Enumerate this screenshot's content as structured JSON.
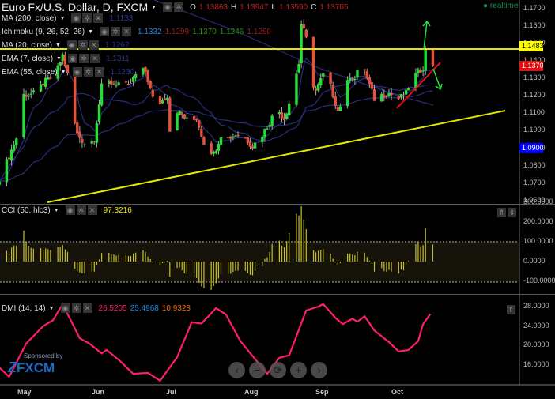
{
  "header": {
    "symbol": "Euro Fx/U.S. Dollar, D, FXCM",
    "o_label": "O",
    "o": "1.13863",
    "h_label": "H",
    "h": "1.13947",
    "l_label": "L",
    "l": "1.13590",
    "c_label": "C",
    "c": "1.13705"
  },
  "realtime": "realtime",
  "indicators": [
    {
      "label": "MA (200, close)",
      "values": [
        {
          "v": "1.1133",
          "color": "#2a3590"
        }
      ]
    },
    {
      "label": "Ichimoku (9, 26, 52, 26)",
      "values": [
        {
          "v": "1.1332",
          "color": "#1e88e5"
        },
        {
          "v": "1.1299",
          "color": "#a01818"
        },
        {
          "v": "1.1370",
          "color": "#2a8a10"
        },
        {
          "v": "1.1246",
          "color": "#2a8a10"
        },
        {
          "v": "1.1260",
          "color": "#a01818"
        }
      ]
    },
    {
      "label": "MA (20, close)",
      "values": [
        {
          "v": "1.1262",
          "color": "#2a3590"
        }
      ]
    },
    {
      "label": "EMA (7, close)",
      "values": [
        {
          "v": "1.1311",
          "color": "#2a3590"
        }
      ]
    },
    {
      "label": "EMA (55, close)",
      "values": [
        {
          "v": "1.1230",
          "color": "#2a3590"
        }
      ]
    }
  ],
  "price_axis": {
    "ticks": [
      "1.1700",
      "1.1600",
      "1.1500",
      "1.1400",
      "1.1300",
      "1.1200",
      "1.1100",
      "1.1000",
      "1.0900",
      "1.0800",
      "1.0700",
      "1.0600"
    ],
    "tags": [
      {
        "v": "1.1483",
        "bg": "#ffff00",
        "fg": "#000"
      },
      {
        "v": "1.1370",
        "bg": "#e01010",
        "fg": "#fff"
      },
      {
        "v": "1.0900",
        "bg": "#0000ff",
        "fg": "#fff"
      }
    ]
  },
  "cci": {
    "label": "CCI (50, hlc3)",
    "value": "97.3216",
    "ticks": [
      "300.0000",
      "200.0000",
      "100.0000",
      "0.0000",
      "-100.0000"
    ]
  },
  "dmi": {
    "label": "DMI (14, 14)",
    "values": [
      {
        "v": "26.5205",
        "color": "#ff1e6e"
      },
      {
        "v": "25.4968",
        "color": "#1e88e5"
      },
      {
        "v": "10.9323",
        "color": "#ff6a00"
      }
    ],
    "ticks": [
      "28.0000",
      "24.0000",
      "20.0000",
      "16.0000"
    ]
  },
  "time_axis": [
    "May",
    "Jun",
    "Jul",
    "Aug",
    "Sep",
    "Oct"
  ],
  "sponsor": {
    "text": "Sponsored by",
    "brand": "FXCM"
  },
  "nav_buttons": [
    "‹",
    "−",
    "⟳",
    "+",
    "›"
  ],
  "colors": {
    "up": "#22e035",
    "down": "#e8503a",
    "ma": "#26307a",
    "horizontal": "#e6e600",
    "dmi": "#ff1e6e",
    "cci": "#c8c020"
  },
  "chart_data": {
    "type": "candlestick",
    "close_path": [
      [
        "2017-04-21",
        1.073
      ],
      [
        "2017-04-24",
        1.0821
      ],
      [
        "2017-04-28",
        1.0957
      ],
      [
        "2017-05-01",
        1.1205
      ],
      [
        "2017-05-06",
        1.1214
      ],
      [
        "2017-05-09",
        1.1273
      ],
      [
        "2017-05-14",
        1.1319
      ],
      [
        "2017-05-17",
        1.1432
      ],
      [
        "2017-05-19",
        1.1319
      ],
      [
        "2017-05-20",
        1.116
      ],
      [
        "2017-05-23",
        1.0979
      ],
      [
        "2017-05-27",
        1.0911
      ],
      [
        "2017-05-30",
        1.0957
      ],
      [
        "2017-06-02",
        1.1251
      ],
      [
        "2017-06-05",
        1.1273
      ],
      [
        "2017-06-09",
        1.1273
      ],
      [
        "2017-06-13",
        1.1251
      ],
      [
        "2017-06-17",
        1.1341
      ],
      [
        "2017-06-20",
        1.1341
      ],
      [
        "2017-06-23",
        1.1183
      ],
      [
        "2017-06-26",
        1.116
      ],
      [
        "2017-06-29",
        1.1205
      ],
      [
        "2017-06-30",
        1.1002
      ],
      [
        "2017-07-03",
        1.1115
      ],
      [
        "2017-07-08",
        1.1047
      ],
      [
        "2017-07-11",
        1.107
      ],
      [
        "2017-07-14",
        1.0934
      ],
      [
        "2017-07-18",
        1.0866
      ],
      [
        "2017-07-21",
        1.0979
      ],
      [
        "2017-07-24",
        1.0957
      ],
      [
        "2017-07-27",
        1.0979
      ],
      [
        "2017-07-31",
        1.0957
      ],
      [
        "2017-08-03",
        1.0911
      ],
      [
        "2017-08-06",
        1.0957
      ],
      [
        "2017-08-09",
        1.1025
      ],
      [
        "2017-08-13",
        1.1128
      ],
      [
        "2017-08-16",
        1.107
      ],
      [
        "2017-08-19",
        1.1205
      ],
      [
        "2017-08-22",
        1.1387
      ],
      [
        "2017-08-23",
        1.1613
      ],
      [
        "2017-08-26",
        1.1477
      ],
      [
        "2017-08-27",
        1.1296
      ],
      [
        "2017-08-29",
        1.1228
      ],
      [
        "2017-09-01",
        1.1319
      ],
      [
        "2017-09-04",
        1.1251
      ],
      [
        "2017-09-07",
        1.1115
      ],
      [
        "2017-09-09",
        1.1183
      ],
      [
        "2017-09-12",
        1.1319
      ],
      [
        "2017-09-14",
        1.1296
      ],
      [
        "2017-09-17",
        1.1409
      ],
      [
        "2017-09-19",
        1.1296
      ],
      [
        "2017-09-22",
        1.1183
      ],
      [
        "2017-09-25",
        1.1205
      ],
      [
        "2017-09-28",
        1.1214
      ],
      [
        "2017-10-02",
        1.1183
      ],
      [
        "2017-10-05",
        1.1214
      ],
      [
        "2017-10-06",
        1.1251
      ],
      [
        "2017-10-09",
        1.1319
      ],
      [
        "2017-10-12",
        1.1364
      ],
      [
        "2017-10-13",
        1.1454
      ],
      [
        "2017-10-15",
        1.1409
      ],
      [
        "2017-10-16",
        1.137
      ]
    ],
    "horizontal_level": 1.1483,
    "ylim": [
      1.06,
      1.17
    ],
    "dmi_adx": [
      [
        "2017-04-21",
        15.5
      ],
      [
        "2017-04-25",
        13.6
      ],
      [
        "2017-05-02",
        20.4
      ],
      [
        "2017-05-09",
        24.0
      ],
      [
        "2017-05-13",
        25.2
      ],
      [
        "2017-05-17",
        28.5
      ],
      [
        "2017-05-24",
        21.5
      ],
      [
        "2017-05-28",
        20.4
      ],
      [
        "2017-06-02",
        18.4
      ],
      [
        "2017-06-04",
        19.1
      ],
      [
        "2017-06-09",
        17.1
      ],
      [
        "2017-06-15",
        14.2
      ],
      [
        "2017-06-21",
        14.4
      ],
      [
        "2017-06-26",
        12.8
      ],
      [
        "2017-07-03",
        17.6
      ],
      [
        "2017-07-09",
        24.8
      ],
      [
        "2017-07-13",
        24.5
      ],
      [
        "2017-07-19",
        27.7
      ],
      [
        "2017-07-23",
        26.4
      ],
      [
        "2017-07-29",
        20.9
      ],
      [
        "2017-08-09",
        14.2
      ],
      [
        "2017-08-14",
        17.5
      ],
      [
        "2017-08-18",
        18.0
      ],
      [
        "2017-08-25",
        27.2
      ],
      [
        "2017-08-30",
        28.0
      ],
      [
        "2017-09-01",
        28.5
      ],
      [
        "2017-09-06",
        25.7
      ],
      [
        "2017-09-09",
        24.4
      ],
      [
        "2017-09-13",
        25.5
      ],
      [
        "2017-09-15",
        24.9
      ],
      [
        "2017-09-18",
        26.0
      ],
      [
        "2017-09-22",
        23.1
      ],
      [
        "2017-09-28",
        20.7
      ],
      [
        "2017-10-02",
        18.8
      ],
      [
        "2017-10-06",
        19.1
      ],
      [
        "2017-10-10",
        20.9
      ],
      [
        "2017-10-12",
        24.4
      ],
      [
        "2017-10-15",
        26.5
      ]
    ],
    "cci_levels": [
      100,
      0,
      -100
    ]
  }
}
